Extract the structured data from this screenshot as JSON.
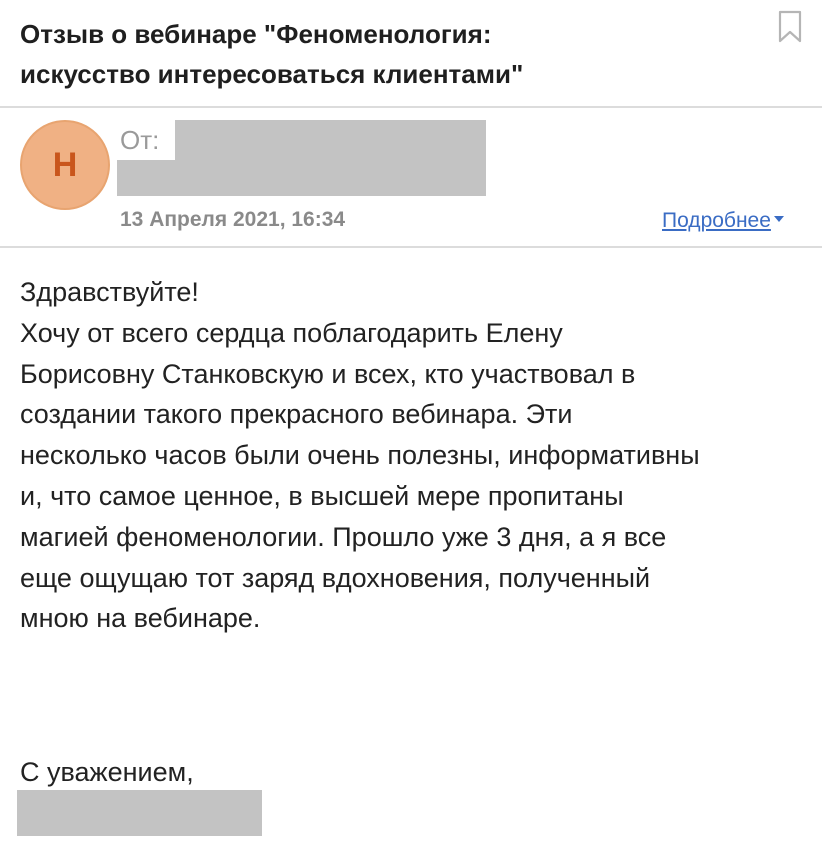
{
  "email": {
    "subject": "Отзыв о вебинаре \"Феноменология:\nискусство интересоваться клиентами\"",
    "sender": {
      "avatar_letter": "Н",
      "from_label": "От:",
      "name": "",
      "address": ""
    },
    "date": "13 Апреля 2021, 16:34",
    "details_link": "Подробнее",
    "body": "Здравствуйте!\nХочу от всего сердца поблагодарить Елену\nБорисовну Станковскую и всех, кто участвовал в\nсоздании такого прекрасного вебинара. Эти\nнесколько часов были очень полезны, информативны\nи, что самое ценное, в высшей мере пропитаны\nмагией феноменологии. Прошло уже 3 дня, а я все\nеще ощущаю тот заряд вдохновения, полученный\nмною на вебинаре.",
    "signoff": "С уважением,",
    "signature_name": ""
  },
  "icons": {
    "bookmark": "bookmark-icon",
    "details_caret": "caret-down-icon"
  },
  "colors": {
    "avatar_bg": "#f0b184",
    "avatar_text": "#c9561c",
    "link": "#3a6cc4",
    "redaction": "#c3c3c3"
  }
}
